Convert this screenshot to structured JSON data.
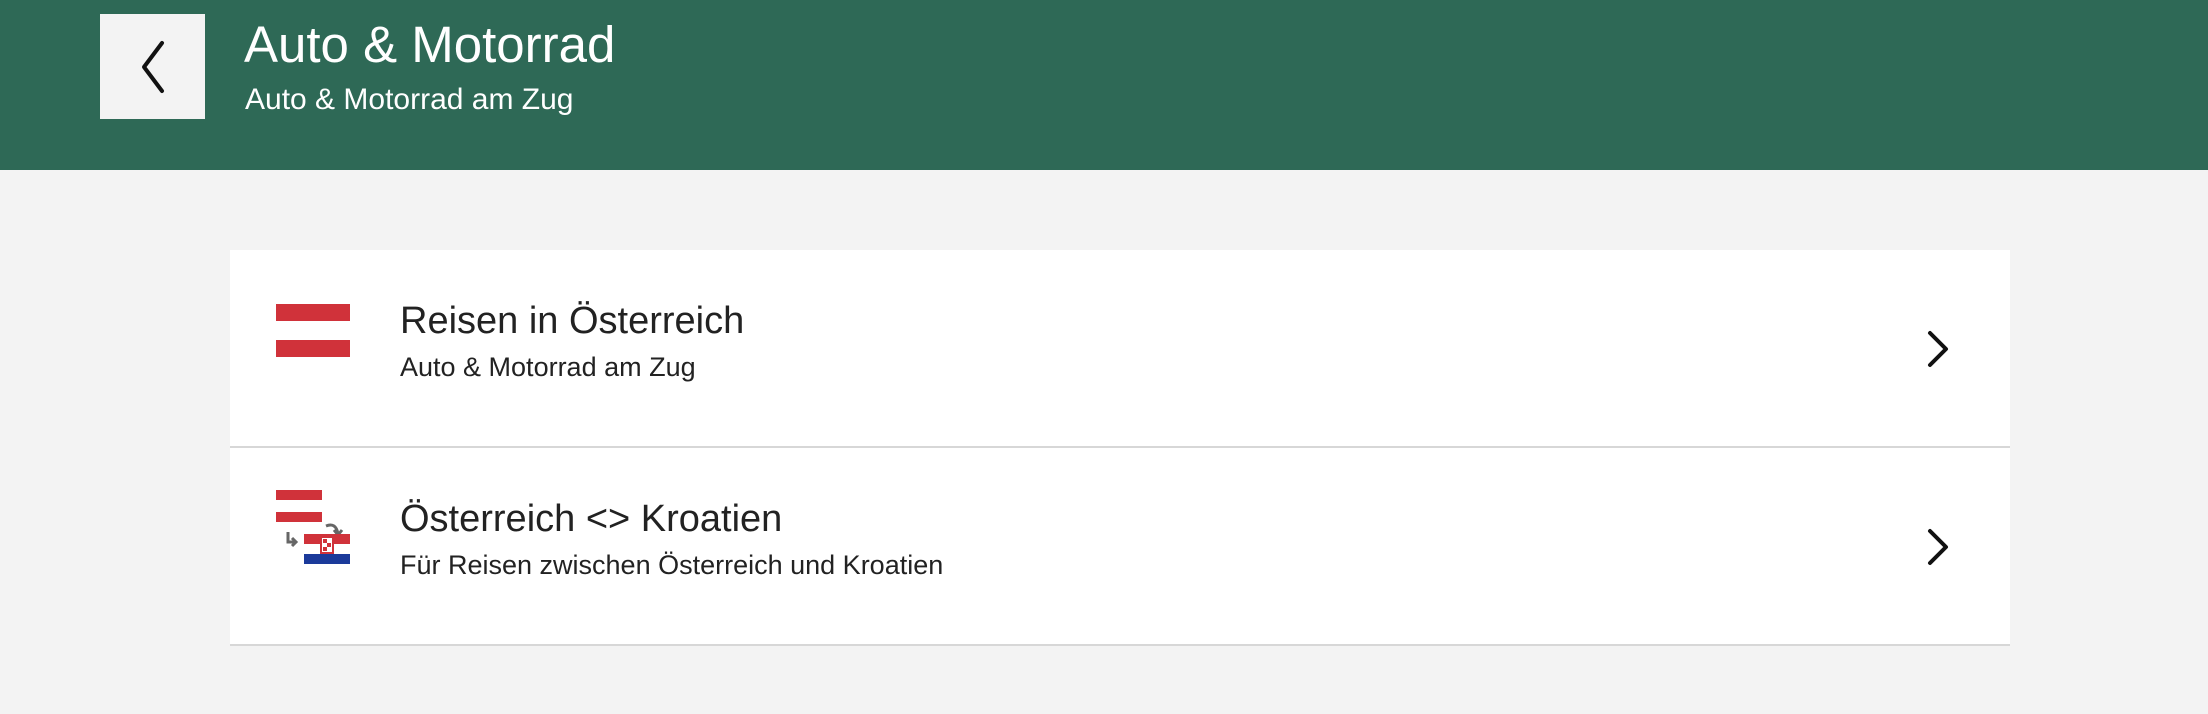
{
  "header": {
    "title": "Auto & Motorrad",
    "subtitle": "Auto & Motorrad am Zug",
    "back_icon": "chevron-left-icon"
  },
  "list": {
    "items": [
      {
        "title": "Reisen in Österreich",
        "subtitle": "Auto & Motorrad am Zug",
        "icon": "austria-flag-icon",
        "chevron": "chevron-right-icon"
      },
      {
        "title": "Österreich <> Kroatien",
        "subtitle": "Für Reisen zwischen Österreich und Kroatien",
        "icon": "austria-croatia-flags-icon",
        "chevron": "chevron-right-icon"
      }
    ]
  },
  "colors": {
    "header_bg": "#2e6956",
    "page_bg": "#f3f3f3",
    "flag_red": "#d0323a",
    "croatia_blue": "#1b3a9a"
  }
}
